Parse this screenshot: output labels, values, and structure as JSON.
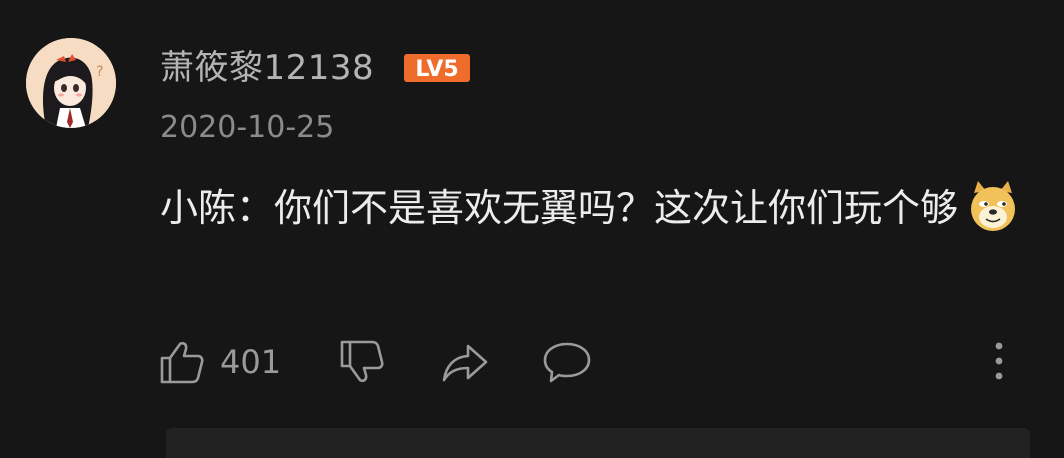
{
  "comment": {
    "username": "萧筱黎12138",
    "level": "LV5",
    "date": "2020-10-25",
    "text": "小陈：你们不是喜欢无翼吗？这次让你们玩个够",
    "emoji": "doge-emoji",
    "likes": "401"
  },
  "icons": {
    "like": "thumbs-up-icon",
    "dislike": "thumbs-down-icon",
    "share": "share-icon",
    "reply": "comment-icon",
    "more": "more-vertical-icon"
  },
  "colors": {
    "background": "#161616",
    "level_badge": "#f06c2b",
    "username": "#b4b4b4",
    "text": "#ececec",
    "icon": "#9a9a9a"
  }
}
